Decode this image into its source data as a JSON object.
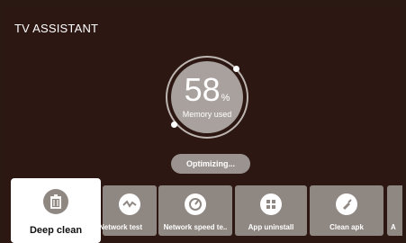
{
  "app": {
    "title": "TV ASSISTANT"
  },
  "memory": {
    "value": "58",
    "unit": "%",
    "label": "Memory used"
  },
  "status": {
    "label": "Optimizing..."
  },
  "tools": [
    {
      "label": "Deep clean",
      "icon": "trash-icon"
    },
    {
      "label": "Network test",
      "icon": "pulse-icon"
    },
    {
      "label": "Network speed te..",
      "icon": "gauge-icon"
    },
    {
      "label": "App uninstall",
      "icon": "grid-icon"
    },
    {
      "label": "Clean apk",
      "icon": "broom-icon"
    },
    {
      "label": "A",
      "icon": "app-icon"
    }
  ]
}
